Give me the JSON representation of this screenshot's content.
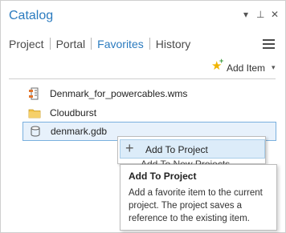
{
  "pane": {
    "title": "Catalog",
    "controls": {
      "dropdown": "▾",
      "pin": "⊥",
      "close": "✕"
    }
  },
  "tabs": [
    {
      "label": "Project",
      "active": false
    },
    {
      "label": "Portal",
      "active": false
    },
    {
      "label": "Favorites",
      "active": true
    },
    {
      "label": "History",
      "active": false
    }
  ],
  "toolbar": {
    "add_item_label": "Add Item",
    "add_item_caret": "▾"
  },
  "favorites": [
    {
      "name": "Denmark_for_powercables.wms",
      "icon": "wms-service-icon"
    },
    {
      "name": "Cloudburst",
      "icon": "folder-icon"
    },
    {
      "name": "denmark.gdb",
      "icon": "geodatabase-icon",
      "selected": true
    }
  ],
  "context_menu": {
    "items": [
      {
        "label": "Add To Project",
        "icon": "plus-icon"
      }
    ],
    "obscured_text": "Add To New Projects"
  },
  "tooltip": {
    "title": "Add To Project",
    "body": "Add a favorite item to the current project. The project saves a reference to the existing item."
  },
  "colors": {
    "accent": "#2b7bbf",
    "selection_bg": "#e7f1fb",
    "menu_hover": "#dcecf9",
    "star": "#f0b400"
  }
}
